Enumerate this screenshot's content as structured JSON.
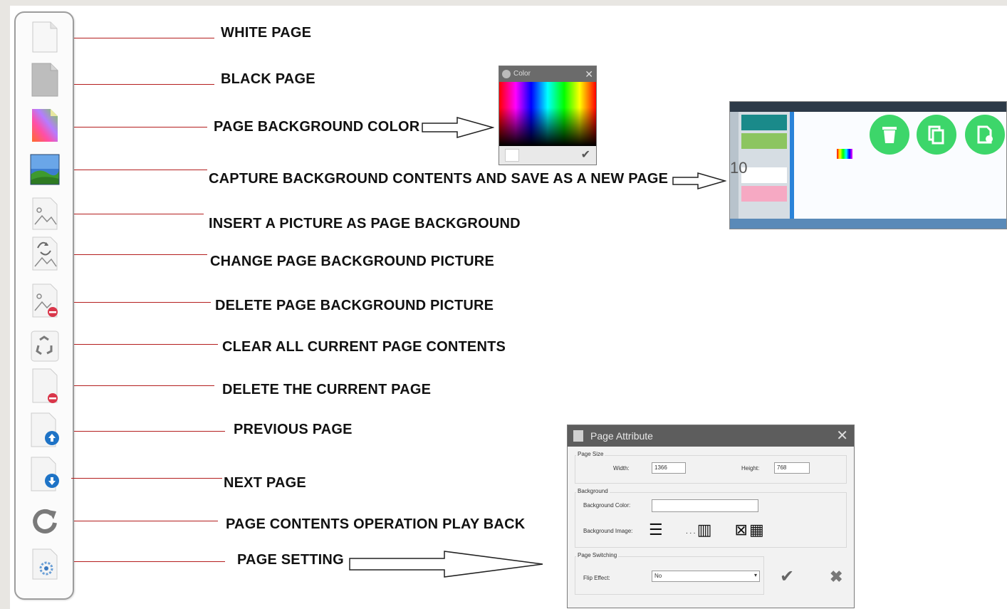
{
  "toolbar": {
    "items": [
      {
        "icon": "white-page-icon",
        "label": "WHITE PAGE"
      },
      {
        "icon": "black-page-icon",
        "label": "BLACK PAGE"
      },
      {
        "icon": "page-background-color-icon",
        "label": "PAGE BACKGROUND COLOR"
      },
      {
        "icon": "capture-background-icon",
        "label": "CAPTURE BACKGROUND CONTENTS AND SAVE AS A NEW PAGE"
      },
      {
        "icon": "insert-picture-icon",
        "label": "INSERT A PICTURE AS PAGE BACKGROUND"
      },
      {
        "icon": "change-picture-icon",
        "label": "CHANGE PAGE BACKGROUND PICTURE"
      },
      {
        "icon": "delete-picture-icon",
        "label": "DELETE PAGE BACKGROUND PICTURE"
      },
      {
        "icon": "recycle-icon",
        "label": "CLEAR ALL CURRENT PAGE CONTENTS"
      },
      {
        "icon": "delete-page-icon",
        "label": "DELETE THE CURRENT PAGE"
      },
      {
        "icon": "page-up-icon",
        "label": "PREVIOUS PAGE"
      },
      {
        "icon": "page-down-icon",
        "label": "NEXT PAGE"
      },
      {
        "icon": "refresh-icon",
        "label": "PAGE CONTENTS OPERATION PLAY BACK"
      },
      {
        "icon": "page-setting-icon",
        "label": "PAGE SETTING"
      }
    ]
  },
  "color_dialog": {
    "title": "Color",
    "close": "✕",
    "ok": "✔"
  },
  "capture_preview": {
    "page_number": "10",
    "buttons": [
      {
        "icon": "trash-icon"
      },
      {
        "icon": "copy-icon"
      },
      {
        "icon": "page-settings-icon"
      }
    ],
    "colors": {
      "accent": "#3dd66a",
      "sidebar_teal": "#1a8a8a",
      "sidebar_green": "#8cc560",
      "sidebar_pink": "#f6a9c3"
    }
  },
  "page_attribute": {
    "title": "Page Attribute",
    "close": "✕",
    "page_size_label": "Page Size",
    "width_label": "Width:",
    "width_value": "1366",
    "height_label": "Height:",
    "height_value": "768",
    "background_label": "Background",
    "bg_color_label": "Background Color:",
    "bg_image_label": "Background Image:",
    "page_switching_label": "Page Switching",
    "flip_effect_label": "Flip Effect:",
    "flip_effect_value": "No",
    "ok": "✔",
    "cancel": "✖"
  },
  "colors": {
    "line": "#b41e1e",
    "label": "#111111",
    "toolbar_border": "#9d9d9d"
  }
}
